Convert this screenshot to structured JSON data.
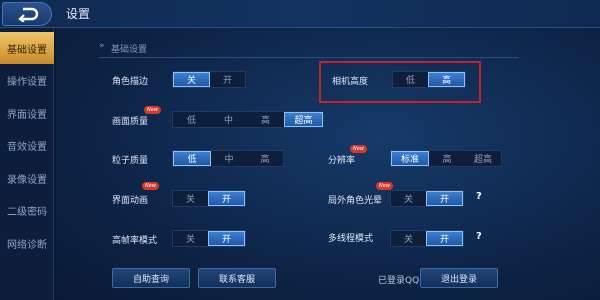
{
  "header": {
    "title": "设置"
  },
  "sidebar": {
    "items": [
      {
        "label": "基础设置",
        "active": true
      },
      {
        "label": "操作设置",
        "active": false
      },
      {
        "label": "界面设置",
        "active": false
      },
      {
        "label": "音效设置",
        "active": false
      },
      {
        "label": "录像设置",
        "active": false
      },
      {
        "label": "二级密码",
        "active": false
      },
      {
        "label": "网络诊断",
        "active": false
      }
    ]
  },
  "section": {
    "title": "基础设置"
  },
  "settings": {
    "outline": {
      "label": "角色描边",
      "options": [
        "关",
        "开"
      ],
      "selected": "关"
    },
    "camera": {
      "label": "相机高度",
      "options": [
        "低",
        "高"
      ],
      "selected": "高"
    },
    "quality": {
      "label": "画面质量",
      "badge": "New",
      "options": [
        "低",
        "中",
        "高",
        "超高"
      ],
      "selected": "超高"
    },
    "particle": {
      "label": "粒子质量",
      "options": [
        "低",
        "中",
        "高"
      ],
      "selected": "低"
    },
    "resolution": {
      "label": "分辨率",
      "badge": "New",
      "options": [
        "标准",
        "高",
        "超高"
      ],
      "selected": "标准"
    },
    "ui_anim": {
      "label": "界面动画",
      "badge": "New",
      "options": [
        "关",
        "开"
      ],
      "selected": "开"
    },
    "halo": {
      "label": "局外角色光晕",
      "badge": "New",
      "options": [
        "关",
        "开"
      ],
      "selected": "开",
      "help": "?"
    },
    "hfr": {
      "label": "高帧率模式",
      "options": [
        "关",
        "开"
      ],
      "selected": "开"
    },
    "multithread": {
      "label": "多线程模式",
      "options": [
        "关",
        "开"
      ],
      "selected": "开",
      "help": "?"
    }
  },
  "footer": {
    "help_button": "自助查询",
    "contact_button": "联系客服",
    "login_status": "已登录QQ",
    "logout_button": "退出登录"
  },
  "colors": {
    "accent": "#2f6fc4",
    "active_tab": "#e0a84a",
    "highlight_box": "#c0232a"
  }
}
